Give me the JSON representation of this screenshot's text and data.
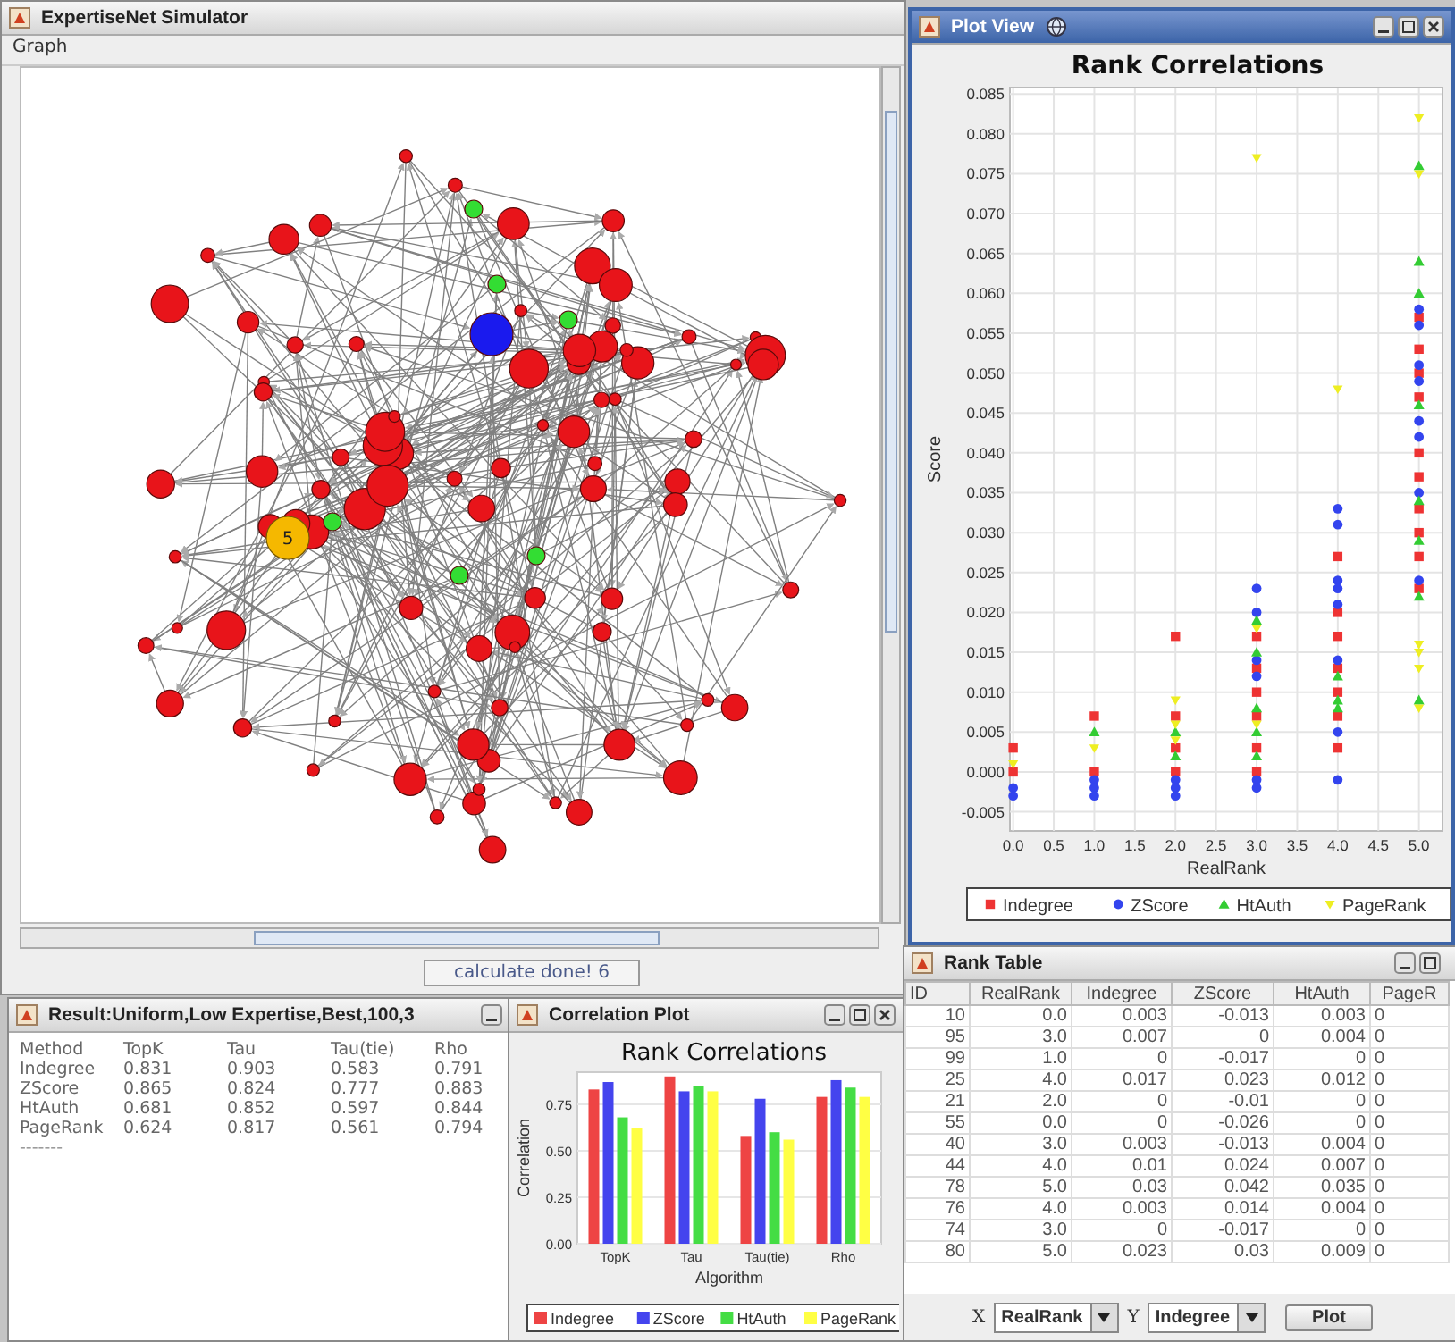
{
  "main_window": {
    "title": "ExpertiseNet Simulator",
    "menu": [
      "Graph"
    ],
    "graph": {
      "labeled_node": {
        "label": "5",
        "color": "#f5b800"
      }
    },
    "status": "calculate done! 6"
  },
  "plot_view": {
    "title": "Plot View",
    "chart_data": {
      "type": "scatter",
      "title": "Rank Correlations",
      "xlabel": "RealRank",
      "ylabel": "Score",
      "grid": true,
      "legend": "bottom",
      "xlim": [
        -0.04,
        5.29
      ],
      "ylim": [
        -0.0074,
        0.0858
      ],
      "xticks": [
        {
          "value": 0,
          "label": "0.0"
        },
        {
          "value": 0.5,
          "label": "0.5"
        },
        {
          "value": 1,
          "label": "1.0"
        },
        {
          "value": 1.5,
          "label": "1.5"
        },
        {
          "value": 2,
          "label": "2.0"
        },
        {
          "value": 2.5,
          "label": "2.5"
        },
        {
          "value": 3,
          "label": "3.0"
        },
        {
          "value": 3.5,
          "label": "3.5"
        },
        {
          "value": 4,
          "label": "4.0"
        },
        {
          "value": 4.5,
          "label": "4.5"
        },
        {
          "value": 5,
          "label": "5.0"
        }
      ],
      "yticks": [
        {
          "value": -0.005,
          "label": "-0.005"
        },
        {
          "value": 0,
          "label": "0.000"
        },
        {
          "value": 0.005,
          "label": "0.005"
        },
        {
          "value": 0.01,
          "label": "0.010"
        },
        {
          "value": 0.015,
          "label": "0.015"
        },
        {
          "value": 0.02,
          "label": "0.020"
        },
        {
          "value": 0.025,
          "label": "0.025"
        },
        {
          "value": 0.03,
          "label": "0.030"
        },
        {
          "value": 0.035,
          "label": "0.035"
        },
        {
          "value": 0.04,
          "label": "0.040"
        },
        {
          "value": 0.045,
          "label": "0.045"
        },
        {
          "value": 0.05,
          "label": "0.050"
        },
        {
          "value": 0.055,
          "label": "0.055"
        },
        {
          "value": 0.06,
          "label": "0.060"
        },
        {
          "value": 0.065,
          "label": "0.065"
        },
        {
          "value": 0.07,
          "label": "0.070"
        },
        {
          "value": 0.075,
          "label": "0.075"
        },
        {
          "value": 0.08,
          "label": "0.080"
        },
        {
          "value": 0.085,
          "label": "0.085"
        }
      ],
      "series": [
        {
          "name": "Indegree",
          "color": "#ee3333",
          "x": [
            0,
            0,
            1,
            1,
            2,
            2,
            2,
            2,
            3,
            3,
            3,
            3,
            3,
            3,
            4,
            4,
            4,
            4,
            4,
            4,
            4,
            5,
            5,
            5,
            5,
            5,
            5,
            5,
            5,
            5,
            5
          ],
          "values": [
            0.003,
            0,
            0.007,
            0,
            0.017,
            0.007,
            0.003,
            0,
            0.017,
            0.013,
            0.01,
            0.007,
            0.003,
            0,
            0.027,
            0.02,
            0.017,
            0.013,
            0.01,
            0.007,
            0.003,
            0.057,
            0.053,
            0.05,
            0.047,
            0.04,
            0.037,
            0.033,
            0.03,
            0.027,
            0.023
          ]
        },
        {
          "name": "ZScore",
          "color": "#3344ee",
          "x": [
            0,
            0,
            1,
            1,
            1,
            2,
            2,
            2,
            3,
            3,
            3,
            3,
            3,
            3,
            4,
            4,
            4,
            4,
            4,
            4,
            4,
            4,
            5,
            5,
            5,
            5,
            5,
            5,
            5,
            5
          ],
          "values": [
            -0.002,
            -0.003,
            -0.001,
            -0.002,
            -0.003,
            -0.001,
            -0.002,
            -0.003,
            0.023,
            0.02,
            0.014,
            0.012,
            -0.001,
            -0.002,
            0.033,
            0.031,
            0.024,
            0.023,
            0.021,
            0.014,
            0.005,
            -0.001,
            0.058,
            0.056,
            0.051,
            0.049,
            0.044,
            0.042,
            0.035,
            0.024
          ]
        },
        {
          "name": "HtAuth",
          "color": "#33cc33",
          "x": [
            1,
            2,
            2,
            3,
            3,
            3,
            3,
            3,
            4,
            4,
            4,
            5,
            5,
            5,
            5,
            5,
            5,
            5,
            5
          ],
          "values": [
            0.005,
            0.002,
            0.005,
            0.019,
            0.015,
            0.008,
            0.005,
            0.002,
            0.012,
            0.009,
            0.008,
            0.076,
            0.064,
            0.06,
            0.046,
            0.034,
            0.029,
            0.022,
            0.009
          ]
        },
        {
          "name": "PageRank",
          "color": "#eeee22",
          "x": [
            0,
            1,
            2,
            2,
            2,
            3,
            3,
            3,
            4,
            5,
            5,
            5,
            5,
            5,
            5
          ],
          "values": [
            0.001,
            0.003,
            0.009,
            0.006,
            0.004,
            0.077,
            0.018,
            0.006,
            0.048,
            0.082,
            0.075,
            0.016,
            0.015,
            0.013,
            0.008
          ]
        }
      ]
    }
  },
  "result_window": {
    "title": "Result:Uniform,Low Expertise,Best,100,3",
    "columns": [
      "Method",
      "TopK",
      "Tau",
      "Tau(tie)",
      "Rho"
    ],
    "rows": [
      [
        "Indegree",
        "0.831",
        "0.903",
        "0.583",
        "0.791"
      ],
      [
        "ZScore",
        "0.865",
        "0.824",
        "0.777",
        "0.883"
      ],
      [
        "HtAuth",
        "0.681",
        "0.852",
        "0.597",
        "0.844"
      ],
      [
        "PageRank",
        "0.624",
        "0.817",
        "0.561",
        "0.794"
      ]
    ],
    "separator": "-------"
  },
  "correlation_plot": {
    "title": "Correlation Plot",
    "chart_data": {
      "type": "bar",
      "title": "Rank Correlations",
      "xlabel": "Algorithm",
      "ylabel": "Correlation",
      "grid": true,
      "legend": "bottom",
      "categories": [
        "TopK",
        "Tau",
        "Tau(tie)",
        "Rho"
      ],
      "ylim": [
        0,
        0.923
      ],
      "yticks": [
        {
          "value": 0,
          "label": "0.00"
        },
        {
          "value": 0.25,
          "label": "0.25"
        },
        {
          "value": 0.5,
          "label": "0.50"
        },
        {
          "value": 0.75,
          "label": "0.75"
        }
      ],
      "series": [
        {
          "name": "Indegree",
          "color": "#ee4444",
          "values": [
            0.83,
            0.9,
            0.58,
            0.79
          ]
        },
        {
          "name": "ZScore",
          "color": "#4444ee",
          "values": [
            0.87,
            0.82,
            0.78,
            0.88
          ]
        },
        {
          "name": "HtAuth",
          "color": "#44dd44",
          "values": [
            0.68,
            0.85,
            0.6,
            0.84
          ]
        },
        {
          "name": "PageRank",
          "color": "#ffff44",
          "values": [
            0.62,
            0.82,
            0.56,
            0.79
          ]
        }
      ]
    }
  },
  "rank_table": {
    "title": "Rank Table",
    "columns": [
      "ID",
      "RealRank",
      "Indegree",
      "ZScore",
      "HtAuth",
      "PageR"
    ],
    "rows": [
      [
        "10",
        "0.0",
        "0.003",
        "-0.013",
        "0.003",
        "0"
      ],
      [
        "95",
        "3.0",
        "0.007",
        "0",
        "0.004",
        "0"
      ],
      [
        "99",
        "1.0",
        "0",
        "-0.017",
        "0",
        "0"
      ],
      [
        "25",
        "4.0",
        "0.017",
        "0.023",
        "0.012",
        "0"
      ],
      [
        "21",
        "2.0",
        "0",
        "-0.01",
        "0",
        "0"
      ],
      [
        "55",
        "0.0",
        "0",
        "-0.026",
        "0",
        "0"
      ],
      [
        "40",
        "3.0",
        "0.003",
        "-0.013",
        "0.004",
        "0"
      ],
      [
        "44",
        "4.0",
        "0.01",
        "0.024",
        "0.007",
        "0"
      ],
      [
        "78",
        "5.0",
        "0.03",
        "0.042",
        "0.035",
        "0"
      ],
      [
        "76",
        "4.0",
        "0.003",
        "0.014",
        "0.004",
        "0"
      ],
      [
        "74",
        "3.0",
        "0",
        "-0.017",
        "0",
        "0"
      ],
      [
        "80",
        "5.0",
        "0.023",
        "0.03",
        "0.009",
        "0"
      ]
    ],
    "x_axis": {
      "label": "X",
      "value": "RealRank"
    },
    "y_axis": {
      "label": "Y",
      "value": "Indegree"
    },
    "plot_button": "Plot"
  }
}
